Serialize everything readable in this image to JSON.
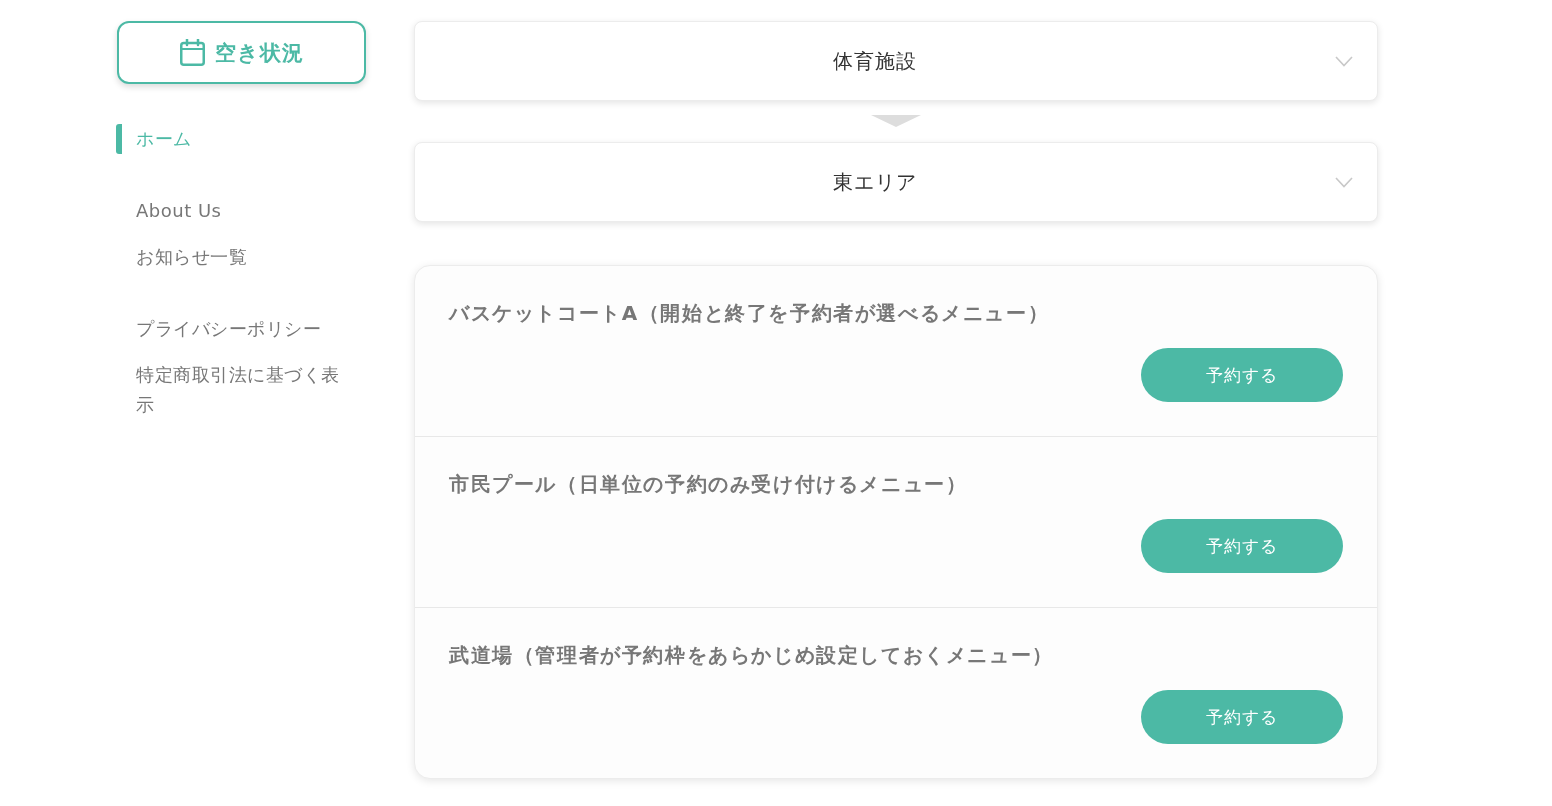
{
  "sidebar": {
    "availability_button": {
      "label": "空き状況"
    },
    "nav_groups": [
      {
        "items": [
          {
            "label": "ホーム",
            "selected": true
          }
        ]
      },
      {
        "items": [
          {
            "label": "About Us",
            "selected": false
          },
          {
            "label": "お知らせ一覧",
            "selected": false
          }
        ]
      },
      {
        "items": [
          {
            "label": "プライバシーポリシー",
            "selected": false
          },
          {
            "label": "特定商取引法に基づく表示",
            "selected": false
          }
        ]
      }
    ]
  },
  "selectors": [
    {
      "value": "体育施設"
    },
    {
      "value": "東エリア"
    }
  ],
  "menus": [
    {
      "title": "バスケットコートA（開始と終了を予約者が選べるメニュー）",
      "button": "予約する"
    },
    {
      "title": "市民プール（日単位の予約のみ受け付けるメニュー）",
      "button": "予約する"
    },
    {
      "title": "武道場（管理者が予約枠をあらかじめ設定しておくメニュー）",
      "button": "予約する"
    }
  ]
}
